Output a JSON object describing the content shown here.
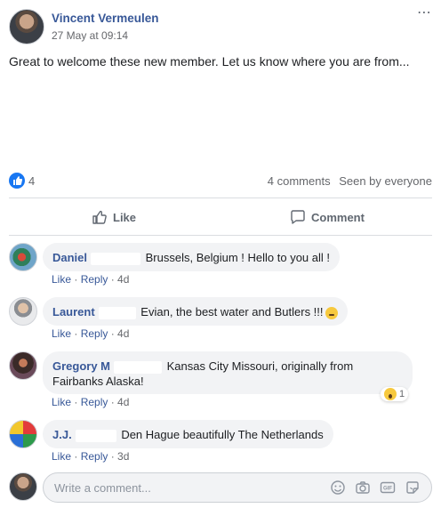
{
  "post": {
    "author": "Vincent Vermeulen",
    "timestamp": "27 May at 09:14",
    "more_icon": "⋯",
    "text": "Great to welcome these new member. Let us know where you are from..."
  },
  "stats": {
    "like_count": "4",
    "comments": "4 comments",
    "seen": "Seen by everyone"
  },
  "actions": {
    "like_label": "Like",
    "comment_label": "Comment"
  },
  "comments": [
    {
      "name": "Daniel",
      "text": "Brussels, Belgium ! Hello to you all !",
      "like": "Like",
      "reply": "Reply",
      "age": "4d"
    },
    {
      "name": "Laurent",
      "text": "Evian, the best water and Butlers !!!",
      "like": "Like",
      "reply": "Reply",
      "age": "4d"
    },
    {
      "name": "Gregory M",
      "text": "Kansas City Missouri, originally from Fairbanks Alaska!",
      "like": "Like",
      "reply": "Reply",
      "age": "4d",
      "reaction_count": "1"
    },
    {
      "name": "J.J.",
      "text": "Den Hague beautifully The Netherlands",
      "like": "Like",
      "reply": "Reply",
      "age": "3d"
    }
  ],
  "composer": {
    "placeholder": "Write a comment..."
  },
  "colors": {
    "link": "#385898",
    "like_blue": "#1877f2",
    "bubble": "#f2f3f5"
  }
}
